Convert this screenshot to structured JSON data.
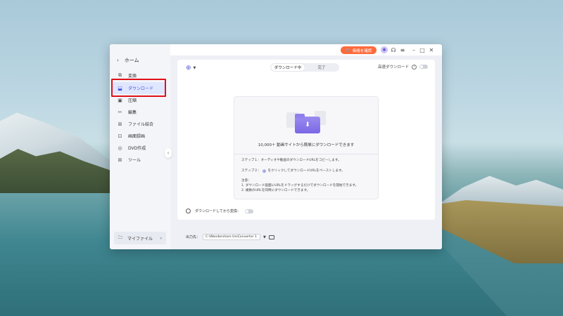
{
  "app": {
    "price_button": "価格を確認",
    "home": "ホーム",
    "nav": [
      {
        "label": "変換",
        "icon": "convert-icon"
      },
      {
        "label": "ダウンロード",
        "icon": "download-icon"
      },
      {
        "label": "圧縮",
        "icon": "compress-icon"
      },
      {
        "label": "編集",
        "icon": "edit-icon"
      },
      {
        "label": "ファイル結合",
        "icon": "merge-icon"
      },
      {
        "label": "画面録画",
        "icon": "record-icon"
      },
      {
        "label": "DVD作成",
        "icon": "dvd-icon"
      },
      {
        "label": "ツール",
        "icon": "tools-icon"
      }
    ],
    "active_nav": "ダウンロード",
    "my_files": "マイファイル"
  },
  "download": {
    "tabs": [
      "ダウンロード中",
      "完了"
    ],
    "high_speed": "高速ダウンロード",
    "card_title": "10,000＋ 動画サイトから簡単にダウンロードできます",
    "step1": "ステップ１：オーディオや動画のダウンロードURLをコピーします。",
    "step2_prefix": "ステップ２：",
    "step2_suffix": "をクリックしてダウンロードURLをペーストします。",
    "notes_title": "注意：",
    "note1": "1. ダウンロード画面にURLをドラッグするだけでダウンロードを開始できます。",
    "note2": "2. 複数のURLを同時にダウンロードできます。",
    "convert_after": "ダウンロードしてから変換：",
    "output_label": "出力先：",
    "output_path": "C:\\Wondershare UniConverter 1"
  },
  "colors": {
    "accent": "#4a55d6",
    "price": "#ff6a3d",
    "highlight": "#e0101a"
  }
}
